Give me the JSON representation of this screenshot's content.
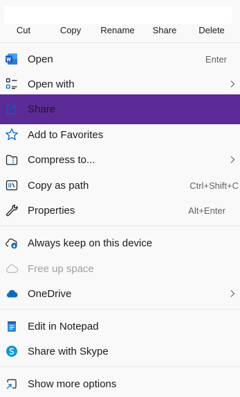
{
  "actions": [
    {
      "label": "Cut",
      "icon": "scissors-icon"
    },
    {
      "label": "Copy",
      "icon": "copy-icon"
    },
    {
      "label": "Rename",
      "icon": "rename-icon"
    },
    {
      "label": "Share",
      "icon": "share-icon"
    },
    {
      "label": "Delete",
      "icon": "trash-icon"
    }
  ],
  "menu": {
    "open": {
      "label": "Open",
      "shortcut": "Enter",
      "icon": "word-icon"
    },
    "open_with": {
      "label": "Open with",
      "icon": "open-with-icon"
    },
    "share": {
      "label": "Share",
      "icon": "share-icon"
    },
    "favorites": {
      "label": "Add to Favorites",
      "icon": "star-icon"
    },
    "compress": {
      "label": "Compress to...",
      "icon": "zip-folder-icon"
    },
    "copy_path": {
      "label": "Copy as path",
      "shortcut": "Ctrl+Shift+C",
      "icon": "copy-path-icon"
    },
    "properties": {
      "label": "Properties",
      "shortcut": "Alt+Enter",
      "icon": "wrench-icon"
    },
    "keep_device": {
      "label": "Always keep on this device",
      "icon": "cloud-download-icon"
    },
    "free_space": {
      "label": "Free up space",
      "icon": "cloud-outline-icon"
    },
    "onedrive": {
      "label": "OneDrive",
      "icon": "onedrive-icon"
    },
    "notepad": {
      "label": "Edit in Notepad",
      "icon": "notepad-icon"
    },
    "skype": {
      "label": "Share with Skype",
      "icon": "skype-icon"
    },
    "more": {
      "label": "Show more options",
      "icon": "show-more-icon"
    }
  },
  "colors": {
    "highlight_border": "#5b2a96",
    "accent": "#0067c0"
  }
}
